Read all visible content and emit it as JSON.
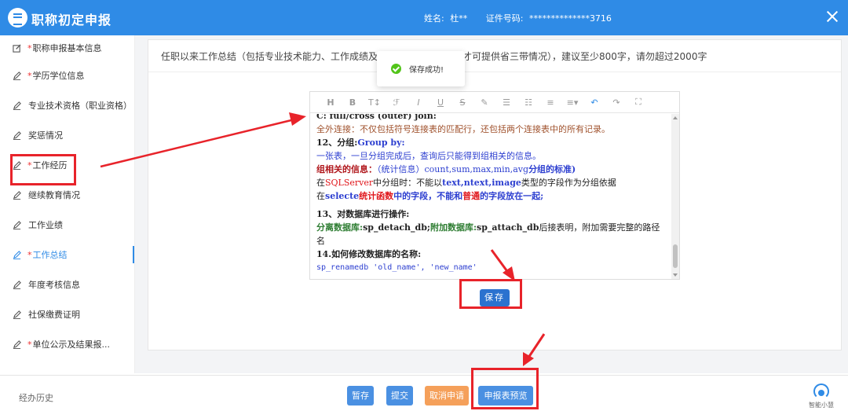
{
  "header": {
    "title": "职称初定申报",
    "name_label": "姓名:",
    "name_value": "杜**",
    "cert_label": "证件号码:",
    "cert_value": "**************3716"
  },
  "sidebar": {
    "items": [
      {
        "label": "职称申报基本信息",
        "required": "*"
      },
      {
        "label": "学历学位信息",
        "required": "*"
      },
      {
        "label": "专业技术资格（职业资格）",
        "required": ""
      },
      {
        "label": "奖惩情况",
        "required": ""
      },
      {
        "label": "工作经历",
        "required": "*"
      },
      {
        "label": "继续教育情况",
        "required": ""
      },
      {
        "label": "工作业绩",
        "required": ""
      },
      {
        "label": "工作总结",
        "required": "*"
      },
      {
        "label": "年度考核信息",
        "required": ""
      },
      {
        "label": "社保缴费证明",
        "required": ""
      },
      {
        "label": "单位公示及结果报...",
        "required": "*"
      }
    ]
  },
  "main": {
    "question": "任职以来工作总结（包括专业技术能力、工作成绩及履行职责等，专才人才可提供省三带情况），建议至少800字，请勿超过2000字",
    "save_label": "保存",
    "toast": "保存成功!"
  },
  "editor": {
    "lines": [
      "C: full/cross (outer) join:",
      "全外连接：不仅包括符号连接表的匹配行，还包括两个连接表中的所有记录。",
      "12、分组:",
      "Group by:",
      "一张表，一旦分组完成后，查询后只能得到组相关的信息。",
      "组相关的信息：",
      "（统计信息）count,sum,max,min,avg",
      "分组的标准)",
      "在",
      "SQLServer",
      "中分组时：不能以",
      "text,ntext,image",
      "类型的字段作为分组依据",
      "在",
      "selecte",
      "统计函数",
      "中的字段，不能和",
      "普通",
      "的字段放在一起;",
      "13、对数据库进行操作:",
      "分离数据库:",
      "sp_detach_db;",
      "附加数据库:",
      "sp_attach_db",
      "后接表明，附加需要完整的路径",
      "名",
      "14.如何修改数据库的名称:",
      "sp_renamedb 'old_name', 'new_name'"
    ]
  },
  "footer": {
    "history": "经办历史",
    "buttons": [
      {
        "label": "暂存",
        "color": "#4a90e2"
      },
      {
        "label": "提交",
        "color": "#4a90e2"
      },
      {
        "label": "取消申请",
        "color": "#f5a05a"
      },
      {
        "label": "申报表预览",
        "color": "#4a90e2"
      }
    ],
    "assistant": "智能小慧"
  },
  "colors": {
    "header": "#2f8be6",
    "primary": "#2b72cf",
    "annotation": "#e8232a"
  }
}
